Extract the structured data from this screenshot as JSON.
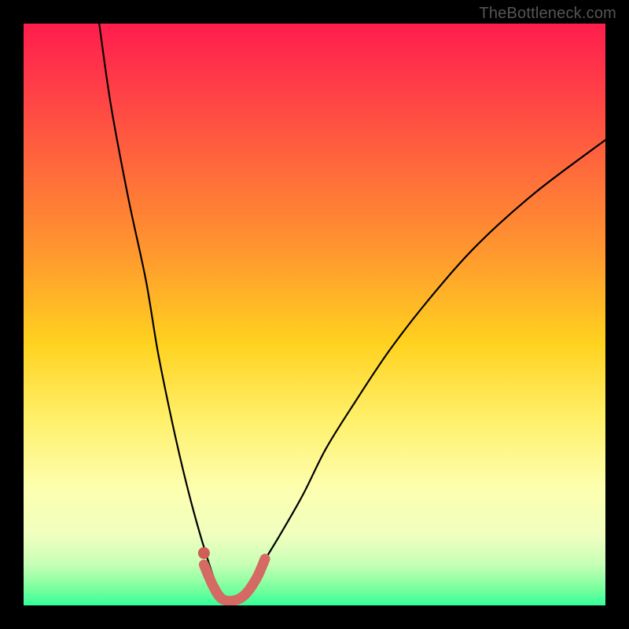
{
  "watermark": {
    "text": "TheBottleneck.com"
  },
  "colors": {
    "curve": "#000000",
    "highlight": "#d46a63",
    "highlight_dot": "#ce5e57"
  },
  "chart_data": {
    "type": "line",
    "title": "",
    "xlabel": "",
    "ylabel": "",
    "xlim": [
      0,
      100
    ],
    "ylim": [
      0,
      100
    ],
    "note": "Axes are unlabeled; x/y read as 0–100% of plot area. Higher y = higher bottleneck. Curve reaches ~0 near x≈33–38.",
    "series": [
      {
        "name": "bottleneck-curve",
        "x": [
          13,
          15,
          18,
          21,
          23,
          25,
          27,
          29,
          31,
          33,
          35,
          37,
          39,
          41,
          44,
          48,
          52,
          57,
          63,
          70,
          78,
          88,
          100
        ],
        "y": [
          100,
          86,
          70,
          56,
          44,
          34,
          25,
          17,
          10,
          4,
          1,
          1,
          3,
          7,
          12,
          19,
          27,
          35,
          44,
          53,
          62,
          71,
          80
        ]
      }
    ],
    "annotations": [
      {
        "name": "highlight-band",
        "type": "line-segment",
        "x": [
          31.0,
          32.5,
          34.0,
          36.0,
          38.0,
          40.0,
          41.5
        ],
        "y": [
          7.0,
          3.5,
          1.2,
          0.8,
          1.8,
          4.6,
          8.0
        ]
      },
      {
        "name": "highlight-dot",
        "type": "point",
        "x": 31.0,
        "y": 9.0
      }
    ]
  }
}
